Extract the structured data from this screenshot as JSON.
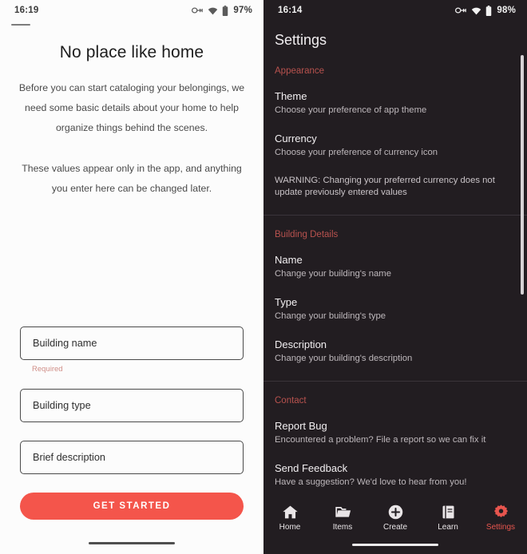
{
  "onboarding": {
    "statusbar": {
      "time": "16:19",
      "battery": "97%",
      "icons": [
        "vpn-key-icon",
        "wifi-icon",
        "battery-icon"
      ]
    },
    "title": "No place like home",
    "paragraph_1": "Before you can start cataloging your belongings, we need some basic details about your home to help organize things behind the scenes.",
    "paragraph_2": "These values appear only in the app, and anything you enter here can be changed later.",
    "fields": [
      {
        "name": "building-name",
        "placeholder": "Building name",
        "value": "",
        "hint": "Required"
      },
      {
        "name": "building-type",
        "placeholder": "Building type",
        "value": "",
        "hint": ""
      },
      {
        "name": "brief-description",
        "placeholder": "Brief description",
        "value": "",
        "hint": ""
      }
    ],
    "cta_label": "GET STARTED",
    "accent_color": "#f4554b",
    "hint_color": "#d08f88"
  },
  "settings": {
    "statusbar": {
      "time": "16:14",
      "battery": "98%",
      "icons": [
        "vpn-key-icon",
        "wifi-icon",
        "battery-icon"
      ]
    },
    "title": "Settings",
    "accent_color": "#b8524e",
    "sections": [
      {
        "header": "Appearance",
        "rows": [
          {
            "title": "Theme",
            "subtitle": "Choose your preference of app theme"
          },
          {
            "title": "Currency",
            "subtitle": "Choose your preference of currency icon"
          }
        ],
        "warning": "WARNING: Changing your preferred currency does not update previously entered values"
      },
      {
        "header": "Building Details",
        "rows": [
          {
            "title": "Name",
            "subtitle": "Change your building's name"
          },
          {
            "title": "Type",
            "subtitle": "Change your building's type"
          },
          {
            "title": "Description",
            "subtitle": "Change your building's description"
          }
        ],
        "warning": ""
      },
      {
        "header": "Contact",
        "rows": [
          {
            "title": "Report Bug",
            "subtitle": "Encountered a problem? File a report so we can fix it"
          },
          {
            "title": "Send Feedback",
            "subtitle": "Have a suggestion? We'd love to hear from you!"
          }
        ],
        "warning": ""
      }
    ],
    "bottom_nav": [
      {
        "label": "Home",
        "icon": "home-icon",
        "active": false
      },
      {
        "label": "Items",
        "icon": "folder-icon",
        "active": false
      },
      {
        "label": "Create",
        "icon": "plus-circle-icon",
        "active": false
      },
      {
        "label": "Learn",
        "icon": "book-icon",
        "active": false
      },
      {
        "label": "Settings",
        "icon": "gear-icon",
        "active": true
      }
    ]
  }
}
